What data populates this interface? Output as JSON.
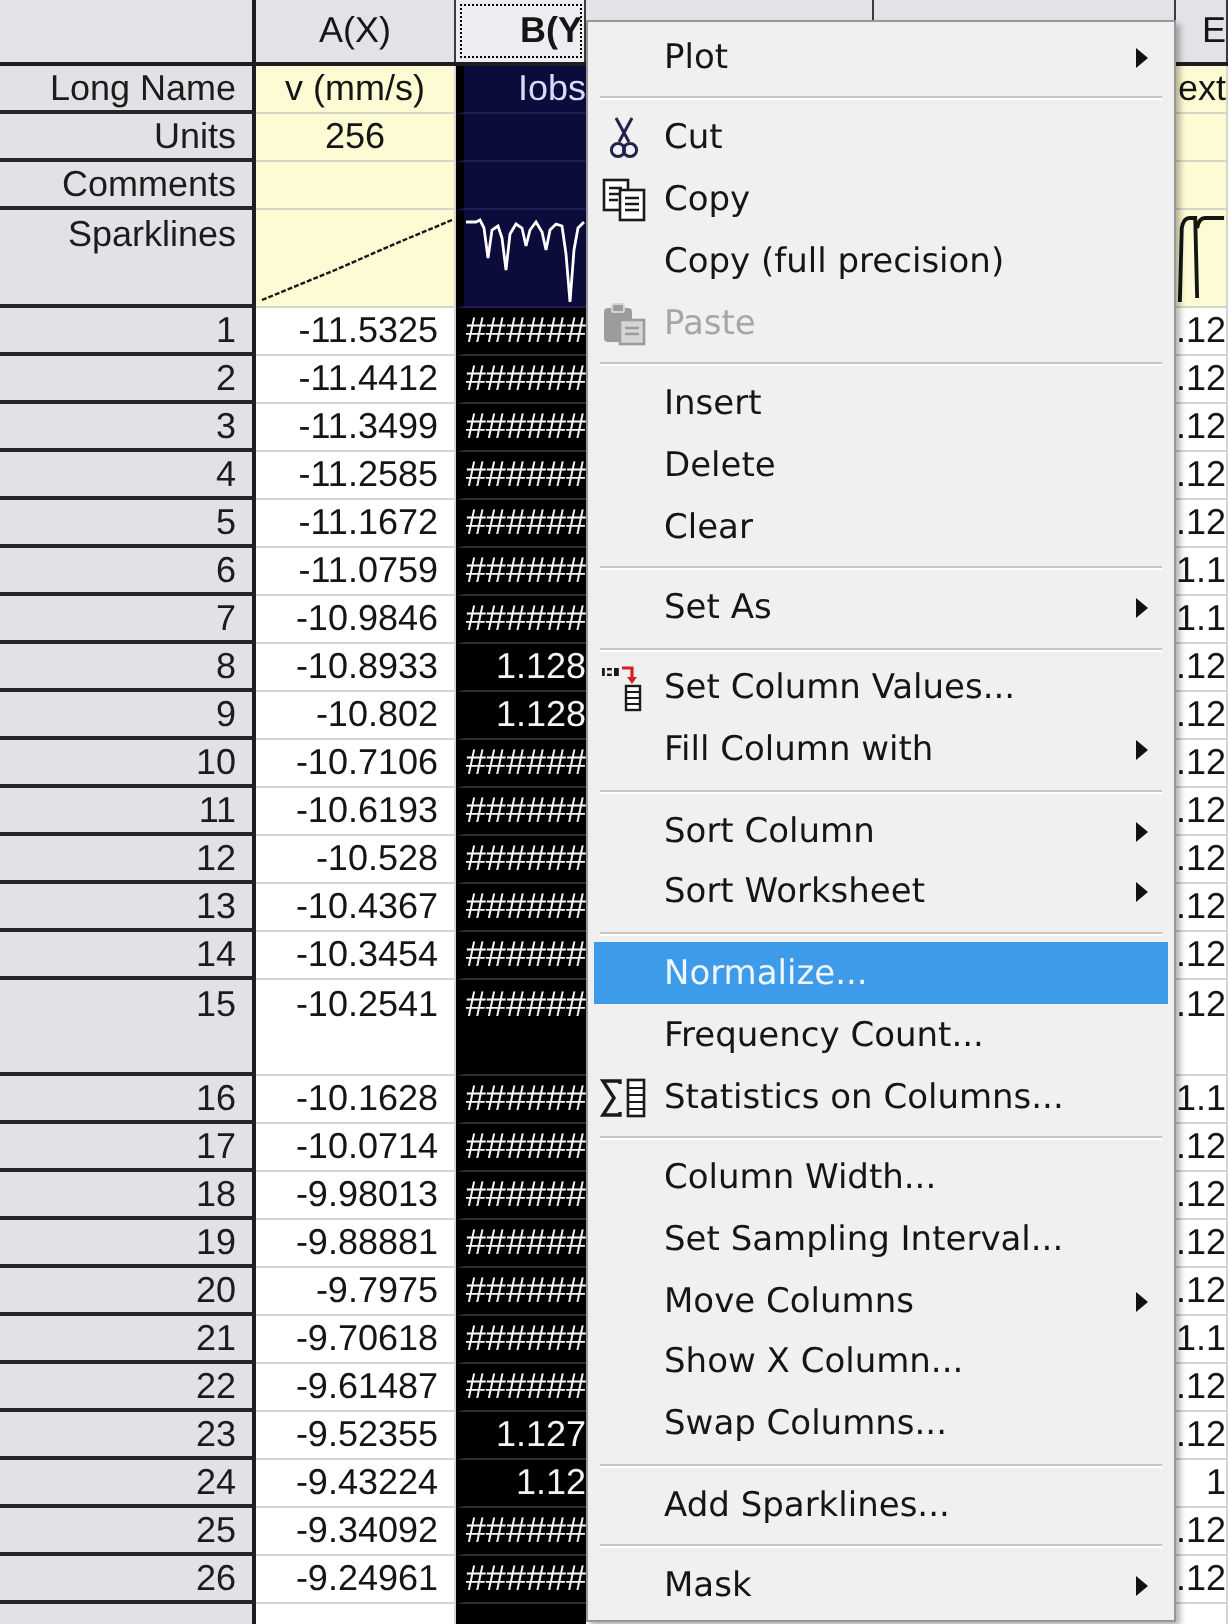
{
  "worksheet": {
    "columns": [
      {
        "kind": "data",
        "header": "A(X)",
        "selected": false
      },
      {
        "kind": "data",
        "header": "B(Y",
        "selected": true
      },
      {
        "kind": "covered"
      },
      {
        "kind": "covered"
      },
      {
        "kind": "data",
        "header": "E",
        "selected": false
      }
    ],
    "label_rows": [
      {
        "label": "Long Name",
        "kind": "text",
        "cells": [
          "v (mm/s)",
          "Iobs",
          "ext"
        ]
      },
      {
        "label": "Units",
        "kind": "text",
        "cells": [
          "256",
          null,
          null
        ]
      },
      {
        "label": "Comments",
        "kind": "text"
      },
      {
        "label": "Sparklines",
        "kind": "sparkline"
      }
    ],
    "rows": [
      {
        "number": "1",
        "tall": false,
        "cells": [
          "-11.5325",
          "######",
          ".12"
        ]
      },
      {
        "number": "2",
        "tall": false,
        "cells": [
          "-11.4412",
          "######",
          ".12"
        ]
      },
      {
        "number": "3",
        "tall": false,
        "cells": [
          "-11.3499",
          "######",
          ".12"
        ]
      },
      {
        "number": "4",
        "tall": false,
        "cells": [
          "-11.2585",
          "######",
          ".12"
        ]
      },
      {
        "number": "5",
        "tall": false,
        "cells": [
          "-11.1672",
          "######",
          ".12"
        ]
      },
      {
        "number": "6",
        "tall": false,
        "cells": [
          "-11.0759",
          "######",
          "1.1"
        ]
      },
      {
        "number": "7",
        "tall": false,
        "cells": [
          "-10.9846",
          "######",
          "1.1"
        ]
      },
      {
        "number": "8",
        "tall": false,
        "cells": [
          "-10.8933",
          "1.128",
          ".12"
        ]
      },
      {
        "number": "9",
        "tall": false,
        "cells": [
          "-10.802",
          "1.128",
          ".12"
        ]
      },
      {
        "number": "10",
        "tall": false,
        "cells": [
          "-10.7106",
          "######",
          ".12"
        ]
      },
      {
        "number": "11",
        "tall": false,
        "cells": [
          "-10.6193",
          "######",
          ".12"
        ]
      },
      {
        "number": "12",
        "tall": false,
        "cells": [
          "-10.528",
          "######",
          ".12"
        ]
      },
      {
        "number": "13",
        "tall": false,
        "cells": [
          "-10.4367",
          "######",
          ".12"
        ]
      },
      {
        "number": "14",
        "tall": false,
        "cells": [
          "-10.3454",
          "######",
          ".12"
        ]
      },
      {
        "number": "15",
        "tall": true,
        "cells": [
          "-10.2541",
          "######",
          ".12"
        ]
      },
      {
        "number": "16",
        "tall": false,
        "cells": [
          "-10.1628",
          "######",
          "1.1"
        ]
      },
      {
        "number": "17",
        "tall": false,
        "cells": [
          "-10.0714",
          "######",
          ".12"
        ]
      },
      {
        "number": "18",
        "tall": false,
        "cells": [
          "-9.98013",
          "######",
          ".12"
        ]
      },
      {
        "number": "19",
        "tall": false,
        "cells": [
          "-9.88881",
          "######",
          ".12"
        ]
      },
      {
        "number": "20",
        "tall": false,
        "cells": [
          "-9.7975",
          "######",
          ".12"
        ]
      },
      {
        "number": "21",
        "tall": false,
        "cells": [
          "-9.70618",
          "######",
          "1.1"
        ]
      },
      {
        "number": "22",
        "tall": false,
        "cells": [
          "-9.61487",
          "######",
          ".12"
        ]
      },
      {
        "number": "23",
        "tall": false,
        "cells": [
          "-9.52355",
          "1.127",
          ".12"
        ]
      },
      {
        "number": "24",
        "tall": false,
        "cells": [
          "-9.43224",
          "1.12",
          "1"
        ]
      },
      {
        "number": "25",
        "tall": false,
        "cells": [
          "-9.34092",
          "######",
          ".12"
        ]
      },
      {
        "number": "26",
        "tall": false,
        "cells": [
          "-9.24961",
          "######",
          ".12"
        ]
      }
    ]
  },
  "context_menu": {
    "sections": [
      {
        "items": [
          {
            "label": "Plot",
            "submenu": true,
            "disabled": false,
            "selected": false
          }
        ]
      },
      {
        "items": [
          {
            "label": "Cut",
            "submenu": false,
            "disabled": false,
            "selected": false
          },
          {
            "label": "Copy",
            "submenu": false,
            "disabled": false,
            "selected": false
          },
          {
            "label": "Copy (full precision)",
            "submenu": false,
            "disabled": false,
            "selected": false
          },
          {
            "label": "Paste",
            "submenu": false,
            "disabled": true,
            "selected": false
          }
        ]
      },
      {
        "items": [
          {
            "label": "Insert",
            "submenu": false,
            "disabled": false,
            "selected": false
          },
          {
            "label": "Delete",
            "submenu": false,
            "disabled": false,
            "selected": false
          },
          {
            "label": "Clear",
            "submenu": false,
            "disabled": false,
            "selected": false
          }
        ]
      },
      {
        "items": [
          {
            "label": "Set As",
            "submenu": true,
            "disabled": false,
            "selected": false
          }
        ]
      },
      {
        "items": [
          {
            "label": "Set Column Values...",
            "submenu": false,
            "disabled": false,
            "selected": false
          },
          {
            "label": "Fill Column with",
            "submenu": true,
            "disabled": false,
            "selected": false
          }
        ]
      },
      {
        "items": [
          {
            "label": "Sort Column",
            "submenu": true,
            "disabled": false,
            "selected": false
          },
          {
            "label": "Sort Worksheet",
            "submenu": true,
            "disabled": false,
            "selected": false
          }
        ]
      },
      {
        "items": [
          {
            "label": "Normalize...",
            "submenu": false,
            "disabled": false,
            "selected": true
          },
          {
            "label": "Frequency Count...",
            "submenu": false,
            "disabled": false,
            "selected": false
          },
          {
            "label": "Statistics on Columns...",
            "submenu": false,
            "disabled": false,
            "selected": false
          }
        ]
      },
      {
        "items": [
          {
            "label": "Column Width...",
            "submenu": false,
            "disabled": false,
            "selected": false
          },
          {
            "label": "Set Sampling Interval...",
            "submenu": false,
            "disabled": false,
            "selected": false
          },
          {
            "label": "Move Columns",
            "submenu": true,
            "disabled": false,
            "selected": false
          },
          {
            "label": "Show X Column...",
            "submenu": false,
            "disabled": false,
            "selected": false
          },
          {
            "label": "Swap Columns...",
            "submenu": false,
            "disabled": false,
            "selected": false
          }
        ]
      },
      {
        "items": [
          {
            "label": "Add Sparklines...",
            "submenu": false,
            "disabled": false,
            "selected": false
          }
        ]
      },
      {
        "items": [
          {
            "label": "Mask",
            "submenu": true,
            "disabled": false,
            "selected": false
          }
        ]
      }
    ]
  }
}
